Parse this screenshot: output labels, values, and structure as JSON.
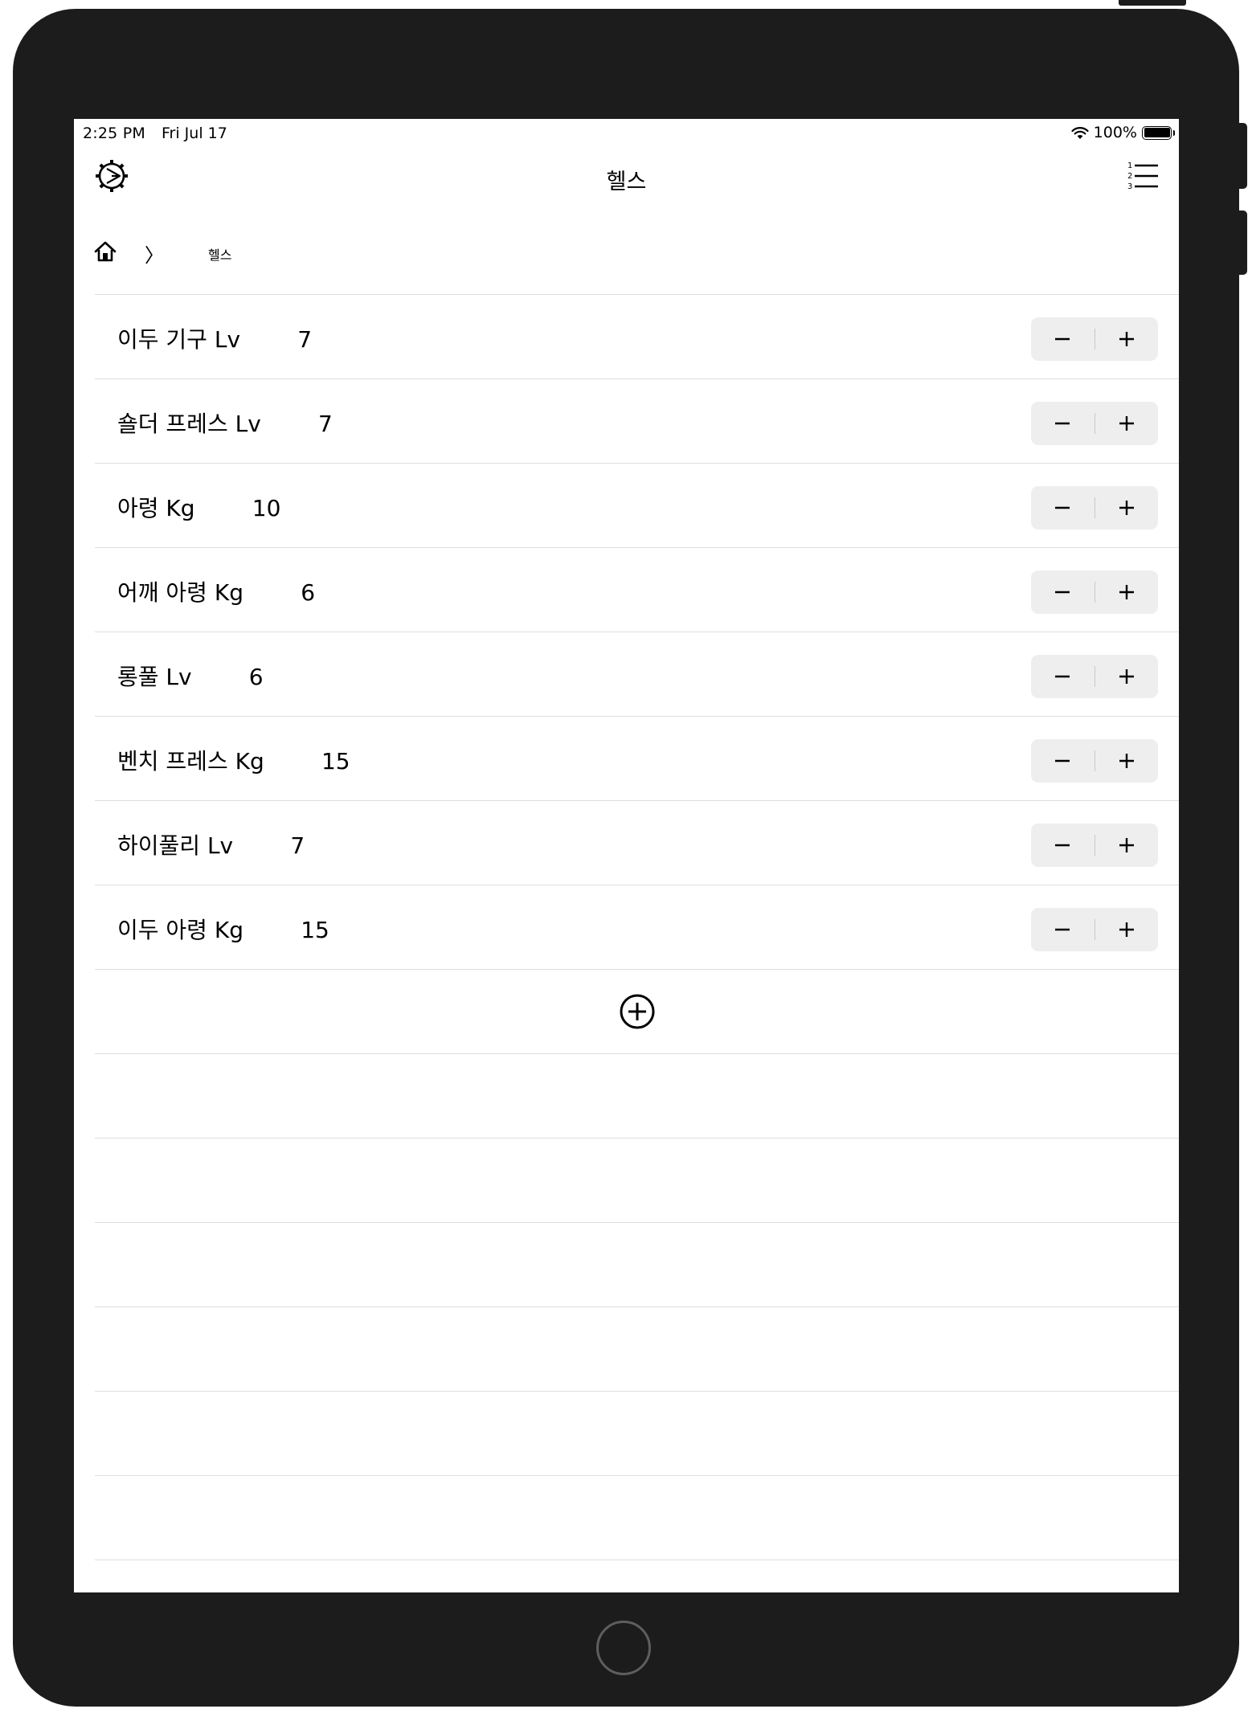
{
  "status_bar": {
    "time": "2:25 PM",
    "date": "Fri Jul 17",
    "battery": "100%",
    "battery_level": 1.0,
    "icons": [
      "wifi-icon",
      "battery-icon"
    ]
  },
  "nav": {
    "title": "헬스",
    "left_icon": "gear-icon",
    "right_icon": "numbered-list-icon"
  },
  "breadcrumb": {
    "home_icon": "home-icon",
    "separator": "〉",
    "current": "헬스"
  },
  "exercises": [
    {
      "name": "이두 기구 Lv",
      "value": "7"
    },
    {
      "name": "숄더 프레스 Lv",
      "value": "7"
    },
    {
      "name": "아령 Kg",
      "value": "10"
    },
    {
      "name": "어깨 아령 Kg",
      "value": "6"
    },
    {
      "name": "롱풀 Lv",
      "value": "6"
    },
    {
      "name": "벤치 프레스 Kg",
      "value": "15"
    },
    {
      "name": "하이풀리 Lv",
      "value": "7"
    },
    {
      "name": "이두 아령 Kg",
      "value": "15"
    }
  ],
  "stepper": {
    "decrement": "−",
    "increment": "+"
  },
  "add_button_icon": "plus-circle-icon",
  "colors": {
    "device_frame": "#1c1c1c",
    "separator": "#dedede",
    "stepper_bg": "#eeeeef"
  }
}
